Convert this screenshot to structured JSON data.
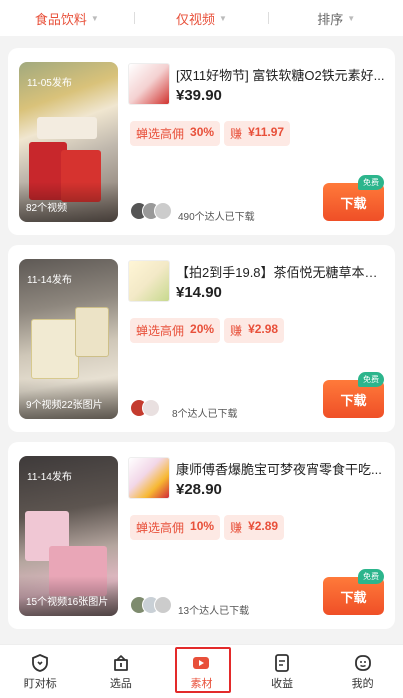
{
  "filters": [
    {
      "label": "食品饮料",
      "active": true
    },
    {
      "label": "仅视频",
      "active": true
    },
    {
      "label": "排序",
      "active": false
    }
  ],
  "cards": [
    {
      "date": "11-05发布",
      "media_count": "82个视频",
      "title": "[双11好物节] 富铁软糖O2铁元素好...",
      "price": "¥39.90",
      "commission_label": "蝉选高佣",
      "commission_rate": "30%",
      "earn_label": "赚",
      "earn_value": "¥11.97",
      "downloads": "490个达人已下载",
      "badge": "免费",
      "button": "下载"
    },
    {
      "date": "11-14发布",
      "media_count": "9个视频22张图片",
      "title": "【拍2到手19.8】茶佰悦无糖草本茶...",
      "price": "¥14.90",
      "commission_label": "蝉选高佣",
      "commission_rate": "20%",
      "earn_label": "赚",
      "earn_value": "¥2.98",
      "downloads": "8个达人已下载",
      "badge": "免费",
      "button": "下载"
    },
    {
      "date": "11-14发布",
      "media_count": "15个视频16张图片",
      "title": "康师傅香爆脆宝可梦夜宵零食干吃...",
      "price": "¥28.90",
      "commission_label": "蝉选高佣",
      "commission_rate": "10%",
      "earn_label": "赚",
      "earn_value": "¥2.89",
      "downloads": "13个达人已下载",
      "badge": "免费",
      "button": "下载"
    }
  ],
  "tabs": [
    {
      "label": "盯对标",
      "icon": "shield-icon"
    },
    {
      "label": "选品",
      "icon": "bag-icon"
    },
    {
      "label": "素材",
      "icon": "play-icon",
      "active": true
    },
    {
      "label": "收益",
      "icon": "document-icon"
    },
    {
      "label": "我的",
      "icon": "smiley-icon"
    }
  ],
  "colors": {
    "accent": "#e8503a",
    "free_badge": "#2cb58c",
    "highlight": "#e32a2a"
  }
}
